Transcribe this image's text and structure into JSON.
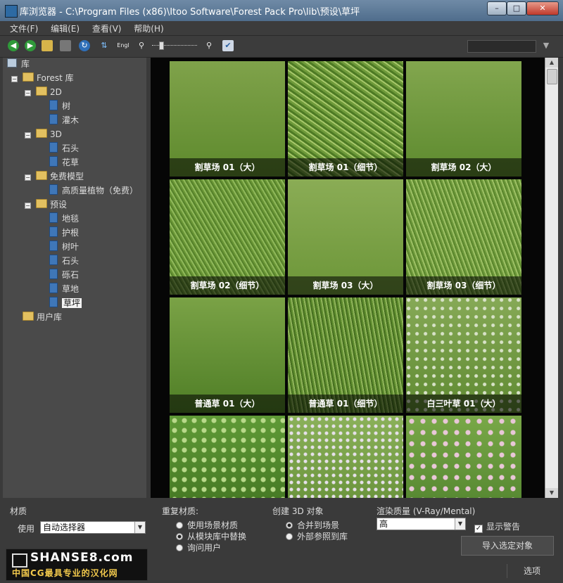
{
  "window": {
    "title": "库浏览器 - C:\\Program Files (x86)\\Itoo Software\\Forest Pack Pro\\lib\\预设\\草坪",
    "minimize": "–",
    "maximize": "□",
    "close": "✕"
  },
  "menu": [
    "文件(F)",
    "编辑(E)",
    "查看(V)",
    "帮助(H)"
  ],
  "toolbar": {
    "icons": [
      "back-icon",
      "forward-icon",
      "open-folder-icon",
      "save-icon",
      "refresh-icon",
      "sort-icon",
      "language-icon",
      "zoom-out-icon",
      "zoom-slider",
      "zoom-in-icon",
      "checklist-icon",
      "filter-icon"
    ],
    "lang_label": "Engl",
    "search_value": ""
  },
  "tree": {
    "root": "库",
    "forest": "Forest 库",
    "g2d": "2D",
    "g2d_items": [
      "树",
      "灌木"
    ],
    "g3d": "3D",
    "g3d_items": [
      "石头",
      "花草"
    ],
    "free": "免费模型",
    "free_items": [
      "高质量植物（免费）"
    ],
    "preset": "预设",
    "preset_items": [
      "地毯",
      "护根",
      "树叶",
      "石头",
      "砾石",
      "草地",
      "草坪"
    ],
    "user": "用户库"
  },
  "thumbnails": [
    {
      "caption": "割草场 01（大）"
    },
    {
      "caption": "割草场 01（细节）"
    },
    {
      "caption": "割草场 02（大）"
    },
    {
      "caption": "割草场 02（细节）"
    },
    {
      "caption": "割草场 03（大）"
    },
    {
      "caption": "割草场 03（细节）"
    },
    {
      "caption": "普通草 01（大）"
    },
    {
      "caption": "普通草 01（细节）"
    },
    {
      "caption": "白三叶草 01（大）"
    },
    {
      "caption": ""
    },
    {
      "caption": ""
    },
    {
      "caption": ""
    }
  ],
  "bottom": {
    "material_label": "材质",
    "use_label": "使用",
    "use_value": "自动选择器",
    "repeat_label": "重复材质:",
    "repeat_options": [
      "使用场景材质",
      "从模块库中替换",
      "询问用户"
    ],
    "repeat_selected": 1,
    "create_label": "创建 3D 对象",
    "create_options": [
      "合并到场景",
      "外部参照到库"
    ],
    "create_selected": 0,
    "quality_label": "渲染质量 (V-Ray/Mental)",
    "quality_value": "高",
    "show_warning": "显示警告",
    "show_warning_checked": true,
    "import_button": "导入选定对象",
    "options_button": "选项"
  },
  "watermark": {
    "line1": "SHANSE8.com",
    "line2": "中国CG最具专业的汉化网"
  },
  "colors": {
    "panel": "#4a4a4a",
    "background": "#3a3a3a",
    "titlebar": "#5f7c9a",
    "grid": "#060606"
  }
}
